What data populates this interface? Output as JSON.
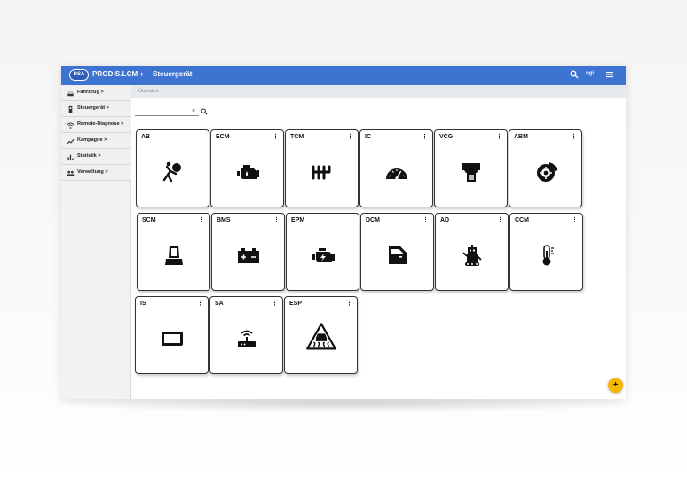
{
  "header": {
    "logo_text": "DSA",
    "brand": "PRODIS.LCM",
    "back_glyph": "‹",
    "title": "Steuergerät",
    "user": "ngi",
    "search_icon": "search-icon",
    "menu_icon": "hamburger-menu-icon"
  },
  "sidebar": {
    "items": [
      {
        "label": "Fahrzeug >",
        "icon": "car-icon"
      },
      {
        "label": "Steuergerät >",
        "icon": "controller-icon"
      },
      {
        "label": "Remote-Diagnose >",
        "icon": "wifi-icon"
      },
      {
        "label": "Kampagne >",
        "icon": "trend-icon"
      },
      {
        "label": "Statistik >",
        "icon": "bar-chart-icon"
      },
      {
        "label": "Verwaltung >",
        "icon": "people-icon"
      }
    ]
  },
  "breadcrumb": "Überblick",
  "search": {
    "value": "",
    "placeholder": "",
    "clear_glyph": "×"
  },
  "tiles": [
    {
      "label": "AB",
      "icon": "airbag-icon"
    },
    {
      "label": "ECM",
      "icon": "engine-icon"
    },
    {
      "label": "TCM",
      "icon": "gearbox-icon"
    },
    {
      "label": "IC",
      "icon": "speedometer-icon"
    },
    {
      "label": "VCG",
      "icon": "gateway-icon"
    },
    {
      "label": "ABM",
      "icon": "brake-disc-icon"
    },
    {
      "label": "SCM",
      "icon": "seat-icon"
    },
    {
      "label": "BMS",
      "icon": "battery-icon"
    },
    {
      "label": "EPM",
      "icon": "engine-power-icon"
    },
    {
      "label": "DCM",
      "icon": "door-icon"
    },
    {
      "label": "AD",
      "icon": "robot-icon"
    },
    {
      "label": "CCM",
      "icon": "thermometer-icon"
    },
    {
      "label": "IS",
      "icon": "screen-icon"
    },
    {
      "label": "SA",
      "icon": "router-icon"
    },
    {
      "label": "ESP",
      "icon": "skid-warning-icon"
    }
  ],
  "tile_menu_glyph": "⋮",
  "fab_label": "+",
  "colors": {
    "header": "#3d73d1",
    "fab": "#f5b800",
    "sidebar": "#f2f2f2"
  }
}
